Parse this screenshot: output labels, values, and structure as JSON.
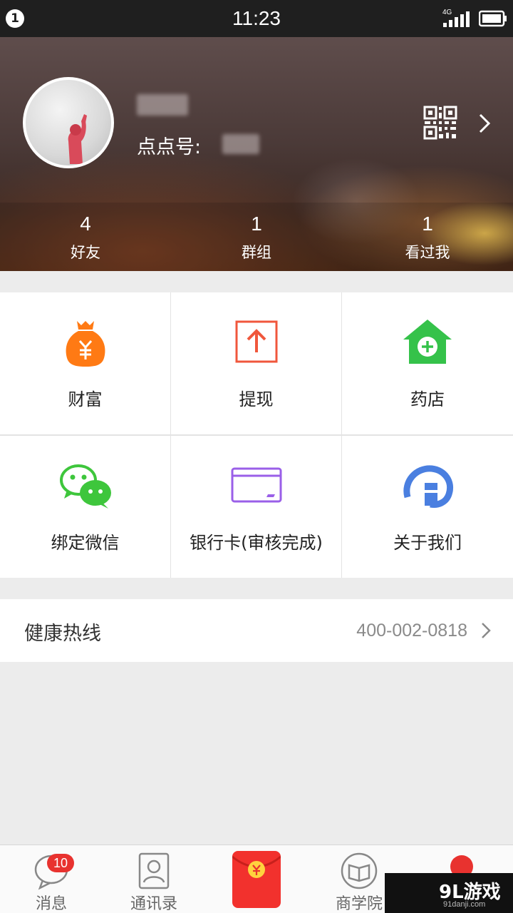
{
  "status_bar": {
    "notification_count": "1",
    "time": "11:23",
    "network": "4G"
  },
  "profile": {
    "id_label": "点点号:",
    "qr_icon": "qr-code-icon"
  },
  "stats": [
    {
      "value": "4",
      "label": "好友"
    },
    {
      "value": "1",
      "label": "群组"
    },
    {
      "value": "1",
      "label": "看过我"
    }
  ],
  "grid": [
    {
      "label": "财富",
      "icon": "money-bag-icon",
      "color": "#ff7a14"
    },
    {
      "label": "提现",
      "icon": "withdraw-icon",
      "color": "#f0573c"
    },
    {
      "label": "药店",
      "icon": "pharmacy-house-icon",
      "color": "#35c24a"
    },
    {
      "label": "绑定微信",
      "icon": "wechat-icon",
      "color": "#3ec63c"
    },
    {
      "label": "银行卡(审核完成)",
      "icon": "bank-card-icon",
      "color": "#9a5fe8"
    },
    {
      "label": "关于我们",
      "icon": "about-logo-icon",
      "color": "#4a7fe0"
    }
  ],
  "hotline": {
    "label": "健康热线",
    "value": "400-002-0818"
  },
  "tabbar": {
    "items": [
      {
        "label": "消息",
        "icon": "message-bubble-icon",
        "badge": "10"
      },
      {
        "label": "通讯录",
        "icon": "contacts-icon"
      },
      {
        "label": "",
        "icon": "red-envelope-icon"
      },
      {
        "label": "商学院",
        "icon": "book-icon"
      },
      {
        "label": "",
        "icon": "me-dot-icon"
      }
    ]
  },
  "watermark": {
    "text": "9L游戏",
    "sub": "91danji.com"
  }
}
